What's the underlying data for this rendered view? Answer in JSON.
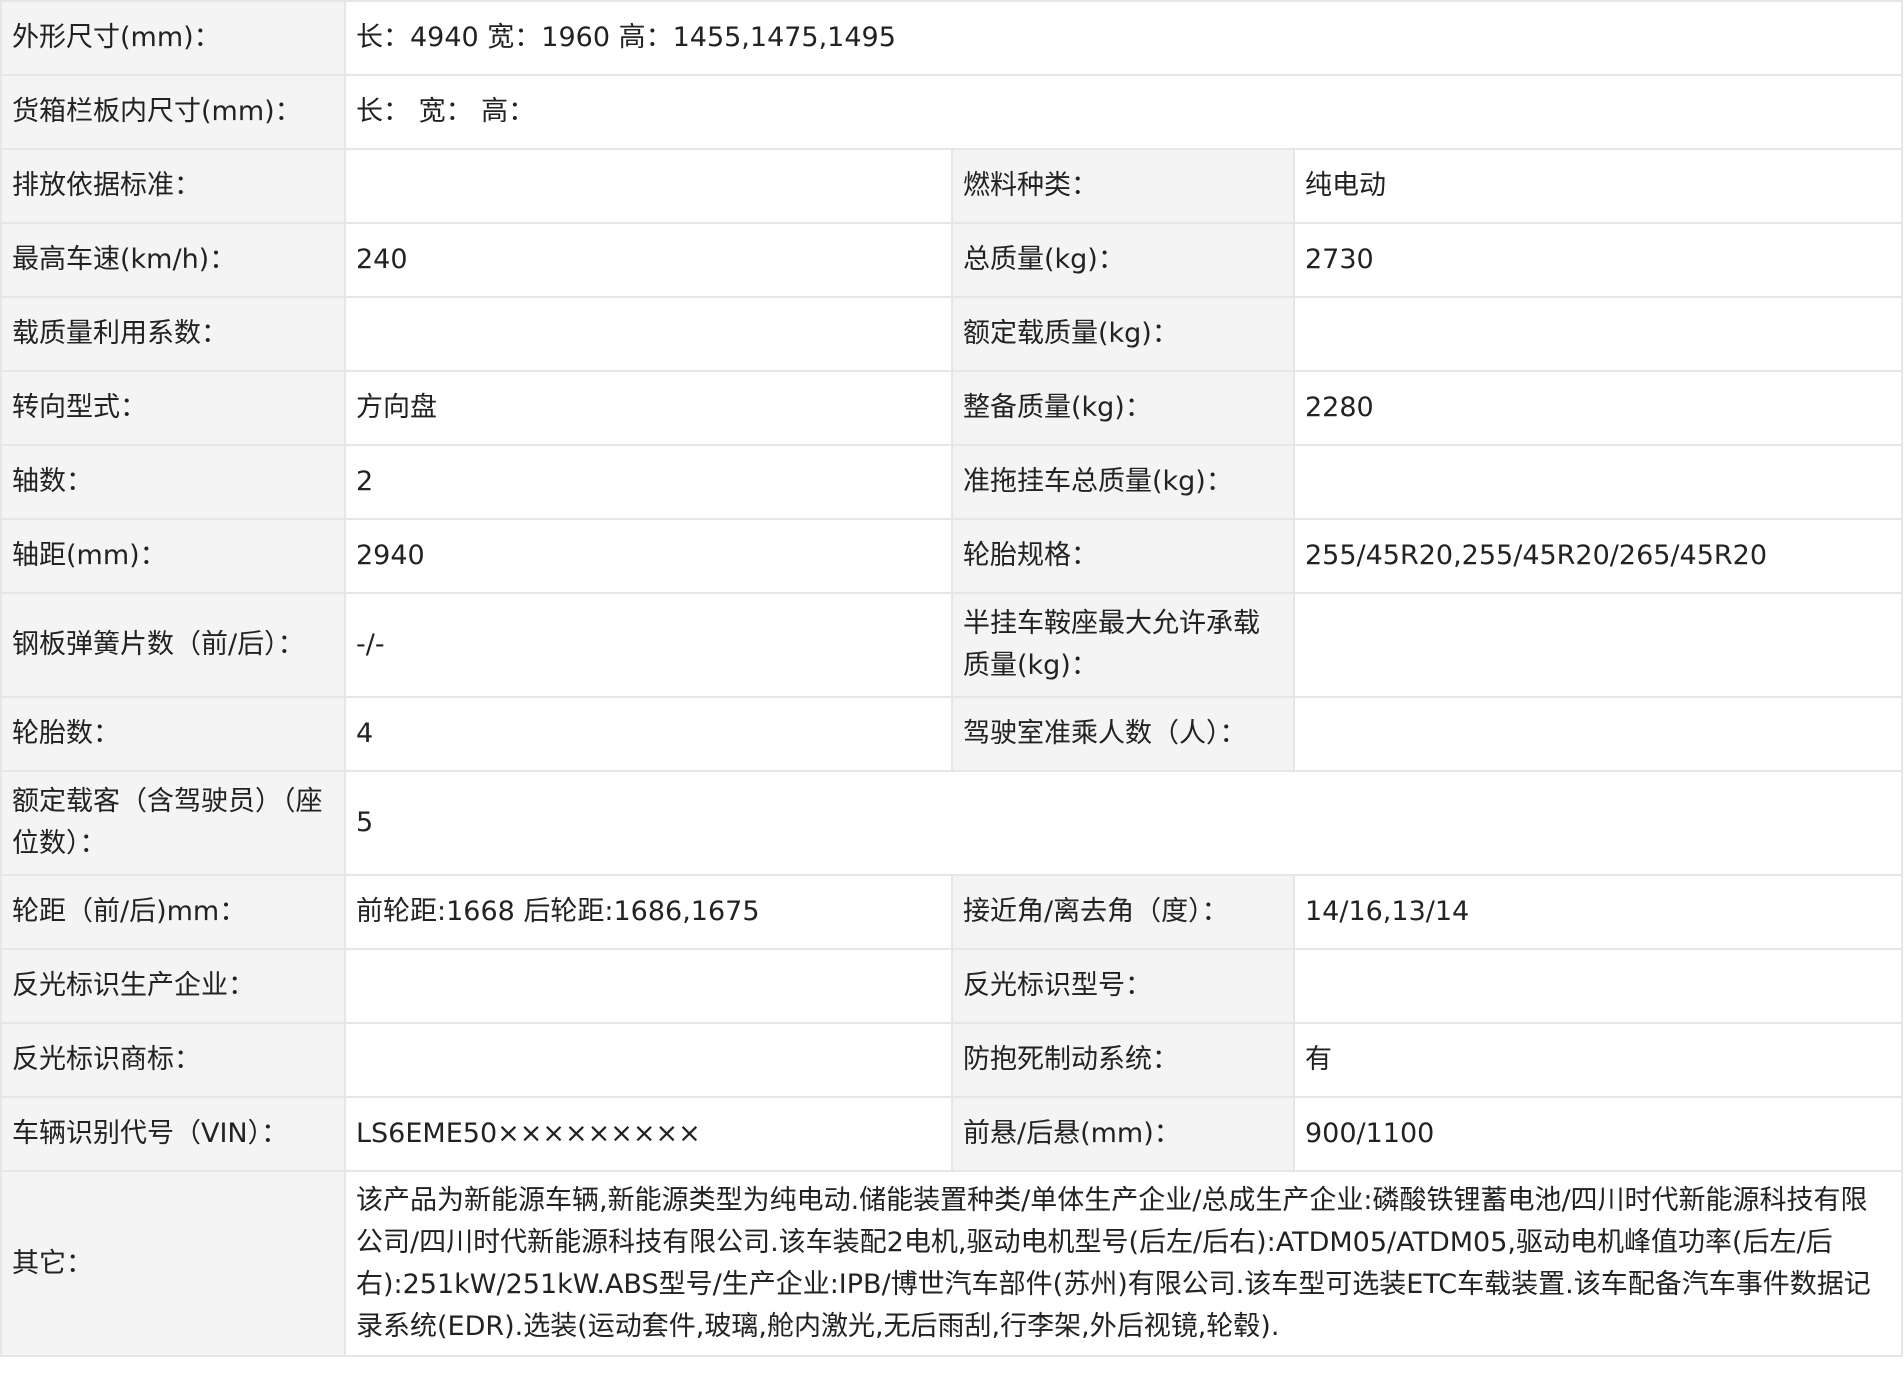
{
  "rows": [
    {
      "l1": "外形尺寸(mm)：",
      "v1": "长：4940 宽：1960 高：1455,1475,1495"
    },
    {
      "l1": "货箱栏板内尺寸(mm)：",
      "v1": "长：  宽：  高："
    },
    {
      "l1": "排放依据标准：",
      "v1": "",
      "l2": "燃料种类：",
      "v2": "纯电动"
    },
    {
      "l1": "最高车速(km/h)：",
      "v1": "240",
      "l2": "总质量(kg)：",
      "v2": "2730"
    },
    {
      "l1": "载质量利用系数：",
      "v1": "",
      "l2": "额定载质量(kg)：",
      "v2": ""
    },
    {
      "l1": "转向型式：",
      "v1": "方向盘",
      "l2": "整备质量(kg)：",
      "v2": "2280"
    },
    {
      "l1": "轴数：",
      "v1": "2",
      "l2": "准拖挂车总质量(kg)：",
      "v2": ""
    },
    {
      "l1": "轴距(mm)：",
      "v1": "2940",
      "l2": "轮胎规格：",
      "v2": "255/45R20,255/45R20/265/45R20"
    },
    {
      "l1": "钢板弹簧片数（前/后）：",
      "v1": "-/-",
      "l2": "半挂车鞍座最大允许承载质量(kg)：",
      "v2": ""
    },
    {
      "l1": "轮胎数：",
      "v1": "4",
      "l2": "驾驶室准乘人数（人）：",
      "v2": ""
    },
    {
      "l1": "额定载客（含驾驶员）（座位数）：",
      "v1": "5"
    },
    {
      "l1": "轮距（前/后)mm：",
      "v1": "前轮距:1668 后轮距:1686,1675",
      "l2": "接近角/离去角（度）：",
      "v2": "14/16,13/14"
    },
    {
      "l1": "反光标识生产企业：",
      "v1": "",
      "l2": "反光标识型号：",
      "v2": ""
    },
    {
      "l1": "反光标识商标：",
      "v1": "",
      "l2": "防抱死制动系统：",
      "v2": "有"
    },
    {
      "l1": "车辆识别代号（VIN）：",
      "v1": "LS6EME50×××××××××",
      "l2": "前悬/后悬(mm)：",
      "v2": "900/1100"
    },
    {
      "l1": "其它：",
      "v1": "该产品为新能源车辆,新能源类型为纯电动.储能装置种类/单体生产企业/总成生产企业:磷酸铁锂蓄电池/四川时代新能源科技有限公司/四川时代新能源科技有限公司.该车装配2电机,驱动电机型号(后左/后右):ATDM05/ATDM05,驱动电机峰值功率(后左/后右):251kW/251kW.ABS型号/生产企业:IPB/博世汽车部件(苏州)有限公司.该车型可选装ETC车载装置.该车配备汽车事件数据记录系统(EDR).选装(运动套件,玻璃,舱内激光,无后雨刮,行李架,外后视镜,轮毂)."
    }
  ]
}
